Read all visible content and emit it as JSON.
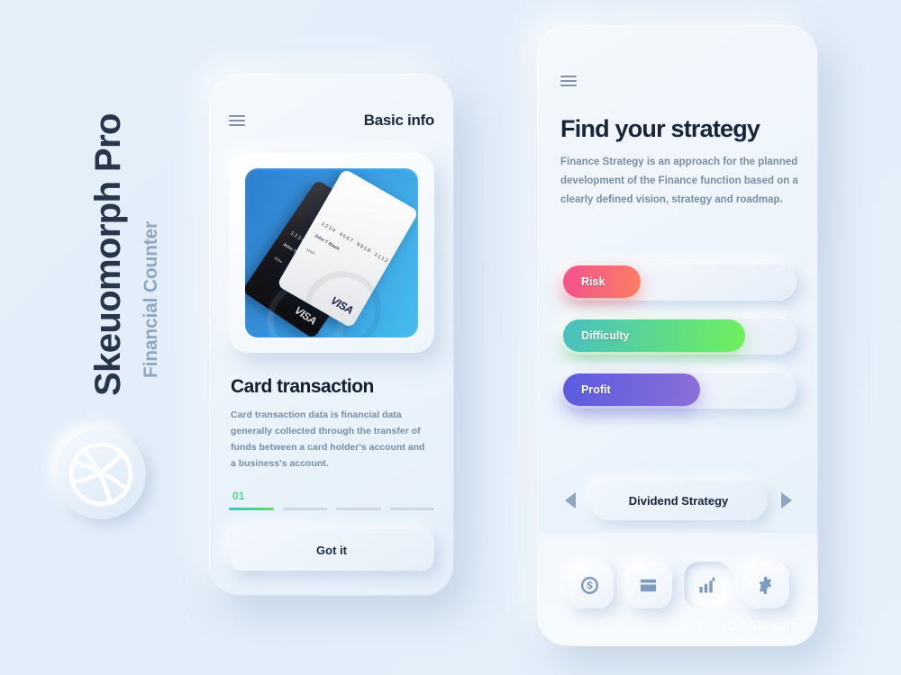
{
  "brand": {
    "title": "Skeuomorph Pro",
    "subtitle": "Financial Counter",
    "logo_icon": "dribbble-logo-icon"
  },
  "watermark": {
    "text": "TOOOPEN.com"
  },
  "phone_basic": {
    "menu_icon": "hamburger-menu-icon",
    "title": "Basic info",
    "card_art": {
      "black_card": {
        "number": "1234 4567 8910 1112",
        "name": "John T Black",
        "expiry": "12/24",
        "brand": "VISA"
      },
      "white_card": {
        "number": "1234 4567 8910 1112",
        "name": "John T Black",
        "expiry": "12/24",
        "brand": "VISA"
      }
    },
    "heading": "Card transaction",
    "body": "Card transaction data is financial data generally collected through the transfer of funds between a card holder's account and a business's account.",
    "step_label": "01",
    "progress": {
      "total": 4,
      "active": 1,
      "active_color": "#56e06a"
    },
    "primary_button": "Got it"
  },
  "phone_strategy": {
    "menu_icon": "hamburger-menu-icon",
    "heading": "Find your strategy",
    "body": "Finance Strategy is an approach for the planned development of the Finance function based on a clearly defined vision, strategy and roadmap.",
    "sliders": [
      {
        "label": "Risk",
        "value": 33,
        "color_from": "#f4508f",
        "color_to": "#fb7f63"
      },
      {
        "label": "Difficulty",
        "value": 77,
        "color_from": "#49bfc2",
        "color_to": "#6ff05c"
      },
      {
        "label": "Profit",
        "value": 58,
        "color_from": "#5a5ce0",
        "color_to": "#8b6fd8"
      }
    ],
    "picker": {
      "prev_icon": "chevron-left-icon",
      "next_icon": "chevron-right-icon",
      "value": "Dividend Strategy"
    },
    "nav_items": [
      {
        "icon": "dollar-coin-icon",
        "active": false
      },
      {
        "icon": "credit-card-icon",
        "active": false
      },
      {
        "icon": "bar-chart-icon",
        "active": true
      },
      {
        "icon": "gear-icon",
        "active": false
      }
    ]
  }
}
